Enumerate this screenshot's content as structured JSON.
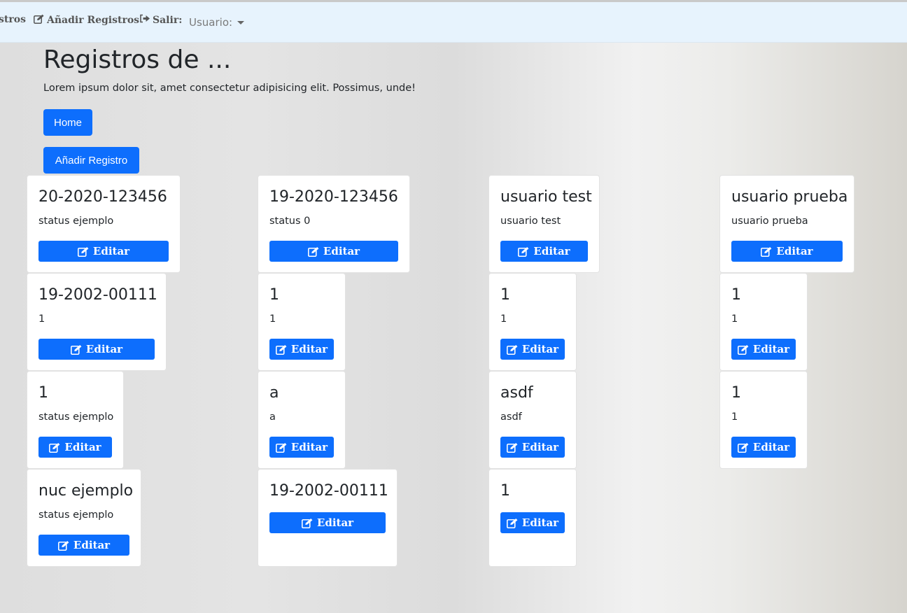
{
  "nav": {
    "items": [
      {
        "label": "stros",
        "icon": ""
      },
      {
        "label": "Añadir Registros",
        "icon": "edit-icon"
      },
      {
        "label": "Salir:",
        "icon": "sign-out-icon"
      }
    ],
    "user_label": "Usuario:"
  },
  "header": {
    "title": "Registros de ...",
    "lead": "Lorem ipsum dolor sit, amet consectetur adipisicing elit. Possimus, unde!",
    "home_button": "Home",
    "add_button": "Añadir Registro"
  },
  "cards": [
    {
      "title": "20-2020-123456",
      "text": "status ejemplo",
      "button": "Editar"
    },
    {
      "title": "19-2020-123456",
      "text": "status 0",
      "button": "Editar"
    },
    {
      "title": "usuario test",
      "text": "usuario test",
      "button": "Editar"
    },
    {
      "title": "usuario prueba",
      "text": "usuario prueba",
      "button": "Editar"
    },
    {
      "title": "19-2002-00111",
      "text": "1",
      "button": "Editar"
    },
    {
      "title": "1",
      "text": "1",
      "button": "Editar"
    },
    {
      "title": "1",
      "text": "1",
      "button": "Editar"
    },
    {
      "title": "1",
      "text": "1",
      "button": "Editar"
    },
    {
      "title": "1",
      "text": "status ejemplo",
      "button": "Editar"
    },
    {
      "title": "a",
      "text": "a",
      "button": "Editar"
    },
    {
      "title": "asdf",
      "text": "asdf",
      "button": "Editar"
    },
    {
      "title": "1",
      "text": "1",
      "button": "Editar"
    },
    {
      "title": "nuc ejemplo",
      "text": "status ejemplo",
      "button": "Editar"
    },
    {
      "title": "19-2002-00111",
      "text": "",
      "button": "Editar"
    },
    {
      "title": "1",
      "text": "",
      "button": "Editar"
    }
  ],
  "colors": {
    "primary": "#0d6efd",
    "navbar": "#e7f3fd"
  }
}
